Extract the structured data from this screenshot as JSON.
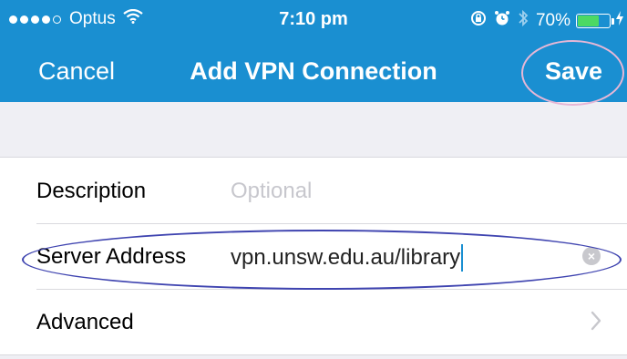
{
  "status_bar": {
    "carrier": "Optus",
    "time": "7:10 pm",
    "battery_percent": "70%",
    "battery_level": 0.7,
    "icons": [
      "signal-dots-icon",
      "wifi-icon",
      "rotation-lock-icon",
      "alarm-icon",
      "bluetooth-icon",
      "battery-icon",
      "charging-bolt-icon"
    ]
  },
  "nav": {
    "cancel_label": "Cancel",
    "title": "Add VPN Connection",
    "save_label": "Save"
  },
  "form": {
    "rows": [
      {
        "label": "Description",
        "value": "",
        "placeholder": "Optional"
      },
      {
        "label": "Server Address",
        "value": "vpn.unsw.edu.au/library"
      },
      {
        "label": "Advanced"
      }
    ]
  },
  "colors": {
    "accent": "#1a8fd1",
    "battery_fill": "#4cd964",
    "annotation_pink": "#e6b7d6",
    "annotation_blue": "#3f44b0"
  }
}
